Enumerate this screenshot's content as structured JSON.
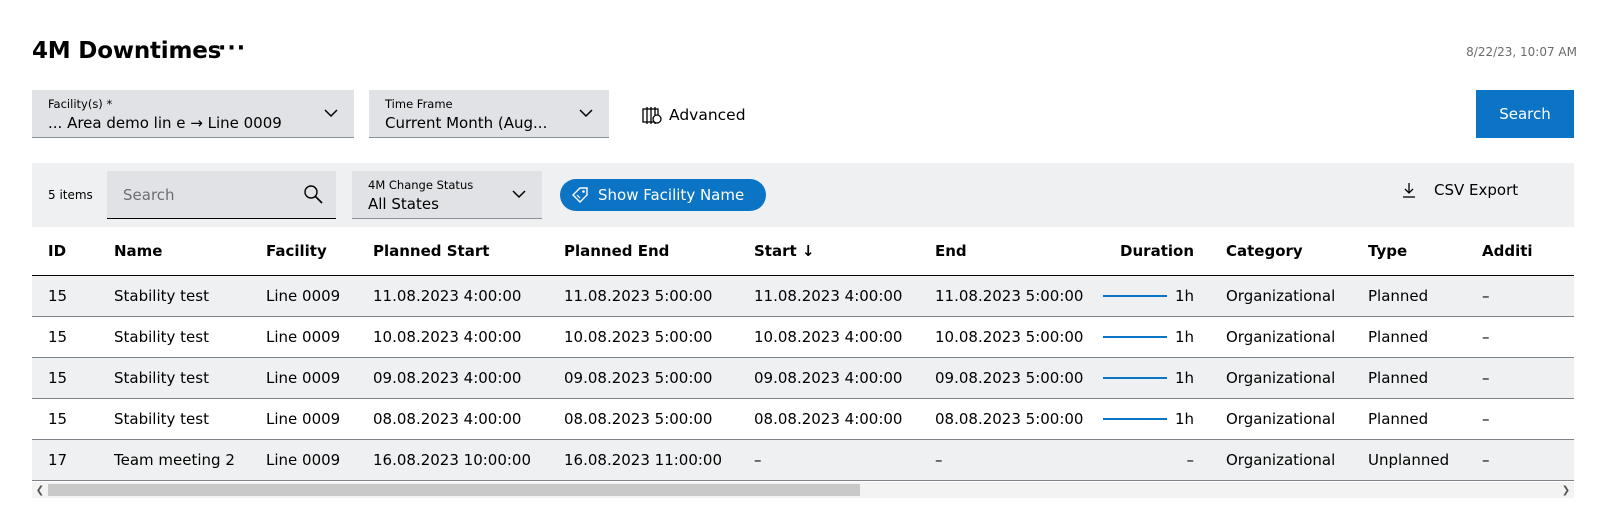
{
  "header": {
    "title": "4M Downtimes",
    "more": "···",
    "timestamp": "8/22/23, 10:07 AM"
  },
  "filters": {
    "facility": {
      "label": "Facility(s) *",
      "value": "... Area demo lin e → Line 0009"
    },
    "timeframe": {
      "label": "Time Frame",
      "value": "Current Month (Aug..."
    },
    "advanced_label": "Advanced",
    "search_label": "Search"
  },
  "toolbar": {
    "items_count": "5 items",
    "search_placeholder": "Search",
    "status": {
      "label": "4M Change Status",
      "value": "All States"
    },
    "facility_toggle": "Show Facility Name",
    "csv_export": "CSV Export"
  },
  "table": {
    "columns": [
      "ID",
      "Name",
      "Facility",
      "Planned Start",
      "Planned End",
      "Start ↓",
      "End",
      "Duration",
      "Category",
      "Type",
      "Additi"
    ],
    "rows": [
      [
        "15",
        "Stability test",
        "Line 0009",
        "11.08.2023 4:00:00",
        "11.08.2023 5:00:00",
        "11.08.2023 4:00:00",
        "11.08.2023 5:00:00",
        "1h",
        "Organizational",
        "Planned",
        "–"
      ],
      [
        "15",
        "Stability test",
        "Line 0009",
        "10.08.2023 4:00:00",
        "10.08.2023 5:00:00",
        "10.08.2023 4:00:00",
        "10.08.2023 5:00:00",
        "1h",
        "Organizational",
        "Planned",
        "–"
      ],
      [
        "15",
        "Stability test",
        "Line 0009",
        "09.08.2023 4:00:00",
        "09.08.2023 5:00:00",
        "09.08.2023 4:00:00",
        "09.08.2023 5:00:00",
        "1h",
        "Organizational",
        "Planned",
        "–"
      ],
      [
        "15",
        "Stability test",
        "Line 0009",
        "08.08.2023 4:00:00",
        "08.08.2023 5:00:00",
        "08.08.2023 4:00:00",
        "08.08.2023 5:00:00",
        "1h",
        "Organizational",
        "Planned",
        "–"
      ],
      [
        "17",
        "Team meeting 2",
        "Line 0009",
        "16.08.2023 10:00:00",
        "16.08.2023 11:00:00",
        "–",
        "–",
        "–",
        "Organizational",
        "Unplanned",
        "–"
      ]
    ]
  },
  "colors": {
    "accent": "#0b74c4",
    "field_bg": "#e0e2e5",
    "toolbar_bg": "#eff0f1"
  },
  "icons": {
    "facility_chevron": "chevron-down-icon",
    "advanced": "filter-settings-icon",
    "search": "search-icon",
    "tag": "tag-icon",
    "export": "download-icon"
  }
}
